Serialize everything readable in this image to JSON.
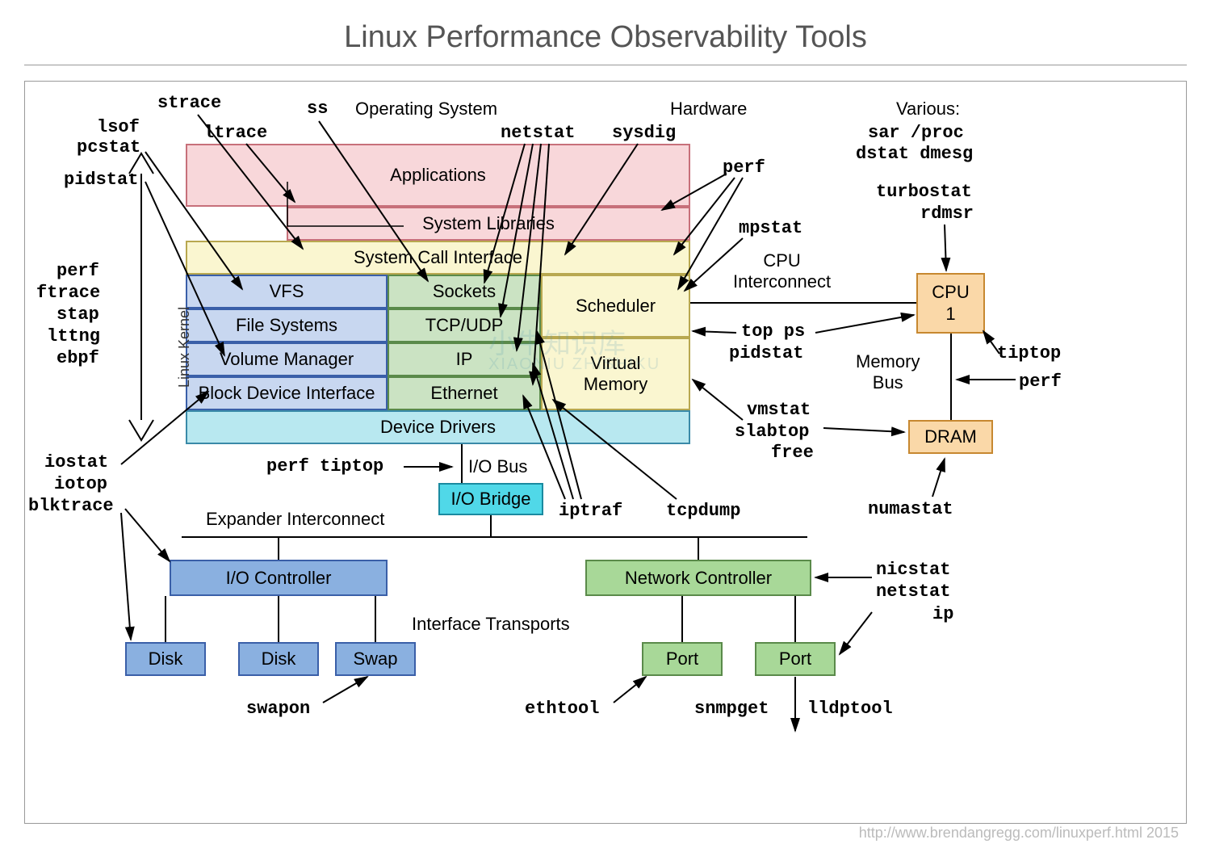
{
  "title": "Linux Performance Observability Tools",
  "sections": {
    "os": "Operating System",
    "hw": "Hardware"
  },
  "os_boxes": {
    "applications": "Applications",
    "syslib": "System Libraries",
    "syscall": "System Call Interface",
    "vfs": "VFS",
    "fs": "File Systems",
    "volman": "Volume Manager",
    "bdi": "Block Device Interface",
    "sockets": "Sockets",
    "tcpudp": "TCP/UDP",
    "ip": "IP",
    "ethernet": "Ethernet",
    "scheduler": "Scheduler",
    "vmem": "Virtual\nMemory",
    "drivers": "Device Drivers"
  },
  "hw_boxes": {
    "cpu": "CPU\n1",
    "dram": "DRAM",
    "iobridge": "I/O Bridge",
    "ioctrl": "I/O Controller",
    "netctrl": "Network Controller",
    "disk1": "Disk",
    "disk2": "Disk",
    "swap": "Swap",
    "port1": "Port",
    "port2": "Port"
  },
  "hw_labels": {
    "cpu_interconnect": "CPU\nInterconnect",
    "memory_bus": "Memory\nBus",
    "io_bus": "I/O Bus",
    "expander": "Expander Interconnect",
    "iface": "Interface Transports",
    "kernel": "Linux Kernel",
    "various": "Various:"
  },
  "tools": {
    "strace": "strace",
    "ss": "ss",
    "lsof": "lsof",
    "pcstat": "pcstat",
    "ltrace": "ltrace",
    "pidstat_top": "pidstat",
    "netstat": "netstat",
    "sysdig": "sysdig",
    "perf_top": "perf",
    "mpstat": "mpstat",
    "sar_proc": "sar /proc",
    "dstat_dmesg": "dstat dmesg",
    "turbostat": "turbostat",
    "rdmsr": "rdmsr",
    "tiptop": "tiptop",
    "perf_cpu": "perf",
    "top_ps": "top ps",
    "pidstat_right": "pidstat",
    "vmstat": "vmstat",
    "slabtop": "slabtop",
    "free": "free",
    "numastat": "numastat",
    "perf_left": "perf",
    "ftrace": "ftrace",
    "stap": "stap",
    "lttng": "lttng",
    "ebpf": "ebpf",
    "iostat": "iostat",
    "iotop": "iotop",
    "blktrace": "blktrace",
    "perf_tiptop": "perf tiptop",
    "iptraf": "iptraf",
    "tcpdump": "tcpdump",
    "nicstat": "nicstat",
    "netstat2": "netstat",
    "ip_tool": "ip",
    "swapon": "swapon",
    "ethtool": "ethtool",
    "snmpget": "snmpget",
    "lldptool": "lldptool"
  },
  "colors": {
    "pink": "#f8d7da",
    "pink_border": "#c7707a",
    "yellow": "#faf6d0",
    "yellow_border": "#b8a850",
    "blue_light": "#c8d7f0",
    "blue_border": "#3a5fa8",
    "green_light": "#cbe3c3",
    "green_border": "#5a8a4a",
    "cyan": "#b8e8f0",
    "cyan_border": "#3a8aa8",
    "orange": "#fad8a8",
    "orange_border": "#c78830",
    "bright_cyan": "#50d8e8",
    "blue_mid": "#8ab0e0",
    "green_mid": "#a8d898"
  },
  "credit": "http://www.brendangregg.com/linuxperf.html 2015",
  "watermark1": "小牛知识库",
  "watermark2": "XIAONIU ZHISHIKU"
}
